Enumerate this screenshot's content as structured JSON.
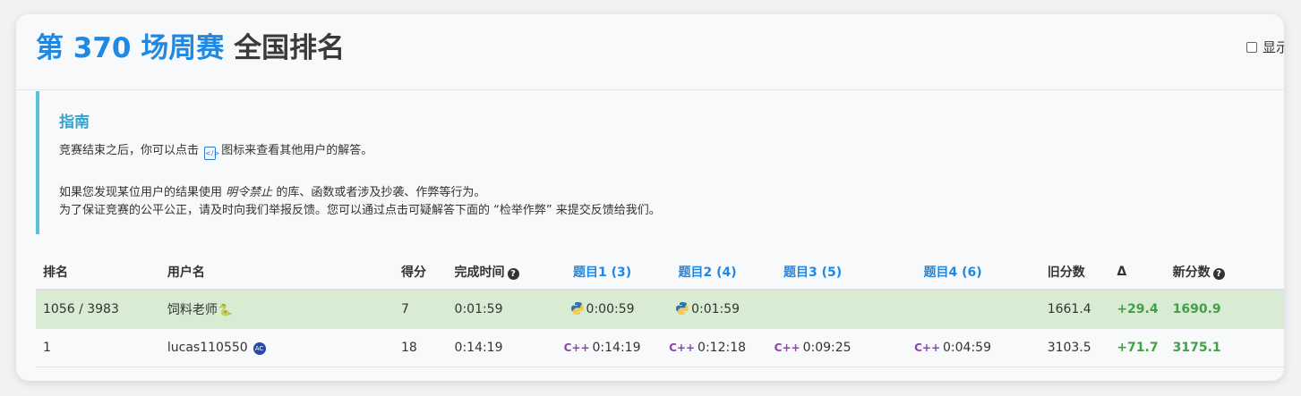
{
  "header": {
    "title_accent": "第 370 场周赛",
    "title_rest": "全国排名",
    "show_toggle_label": "显示"
  },
  "guide": {
    "title": "指南",
    "line1_a": "竞赛结束之后，你可以点击",
    "line1_b": "图标来查看其他用户的解答。",
    "line2_a": "如果您发现某位用户的结果使用",
    "line2_em": "明令禁止",
    "line2_b": "的库、函数或者涉及抄袭、作弊等行为。",
    "line3": "为了保证竞赛的公平公正，请及时向我们举报反馈。您可以通过点击可疑解答下面的 “检举作弊” 来提交反馈给我们。"
  },
  "table": {
    "headers": {
      "rank": "排名",
      "user": "用户名",
      "score": "得分",
      "finish_time": "完成时间",
      "q1": "题目1 (3)",
      "q2": "题目2 (4)",
      "q3": "题目3 (5)",
      "q4": "题目4 (6)",
      "old": "旧分数",
      "delta": "Δ",
      "new": "新分数"
    },
    "rows": [
      {
        "rank": "1056 / 3983",
        "user": "饲料老师",
        "score": "7",
        "finish_time": "0:01:59",
        "q1": "0:00:59",
        "q1_lang": "python",
        "q2": "0:01:59",
        "q2_lang": "python",
        "q3": "",
        "q4": "",
        "old": "1661.4",
        "delta": "+29.4",
        "new": "1690.9"
      },
      {
        "rank": "1",
        "user": "lucas110550",
        "score": "18",
        "finish_time": "0:14:19",
        "q1": "0:14:19",
        "q1_lang": "cpp",
        "q2": "0:12:18",
        "q2_lang": "cpp",
        "q3": "0:09:25",
        "q3_lang": "cpp",
        "q4": "0:04:59",
        "q4_lang": "cpp",
        "old": "3103.5",
        "delta": "+71.7",
        "new": "3175.1"
      }
    ]
  },
  "colors": {
    "accent": "#1e88e5",
    "guide_border": "#5bc0de",
    "highlight_row": "#d7ecd3",
    "positive": "#43a047",
    "cpp": "#8e44ad"
  }
}
